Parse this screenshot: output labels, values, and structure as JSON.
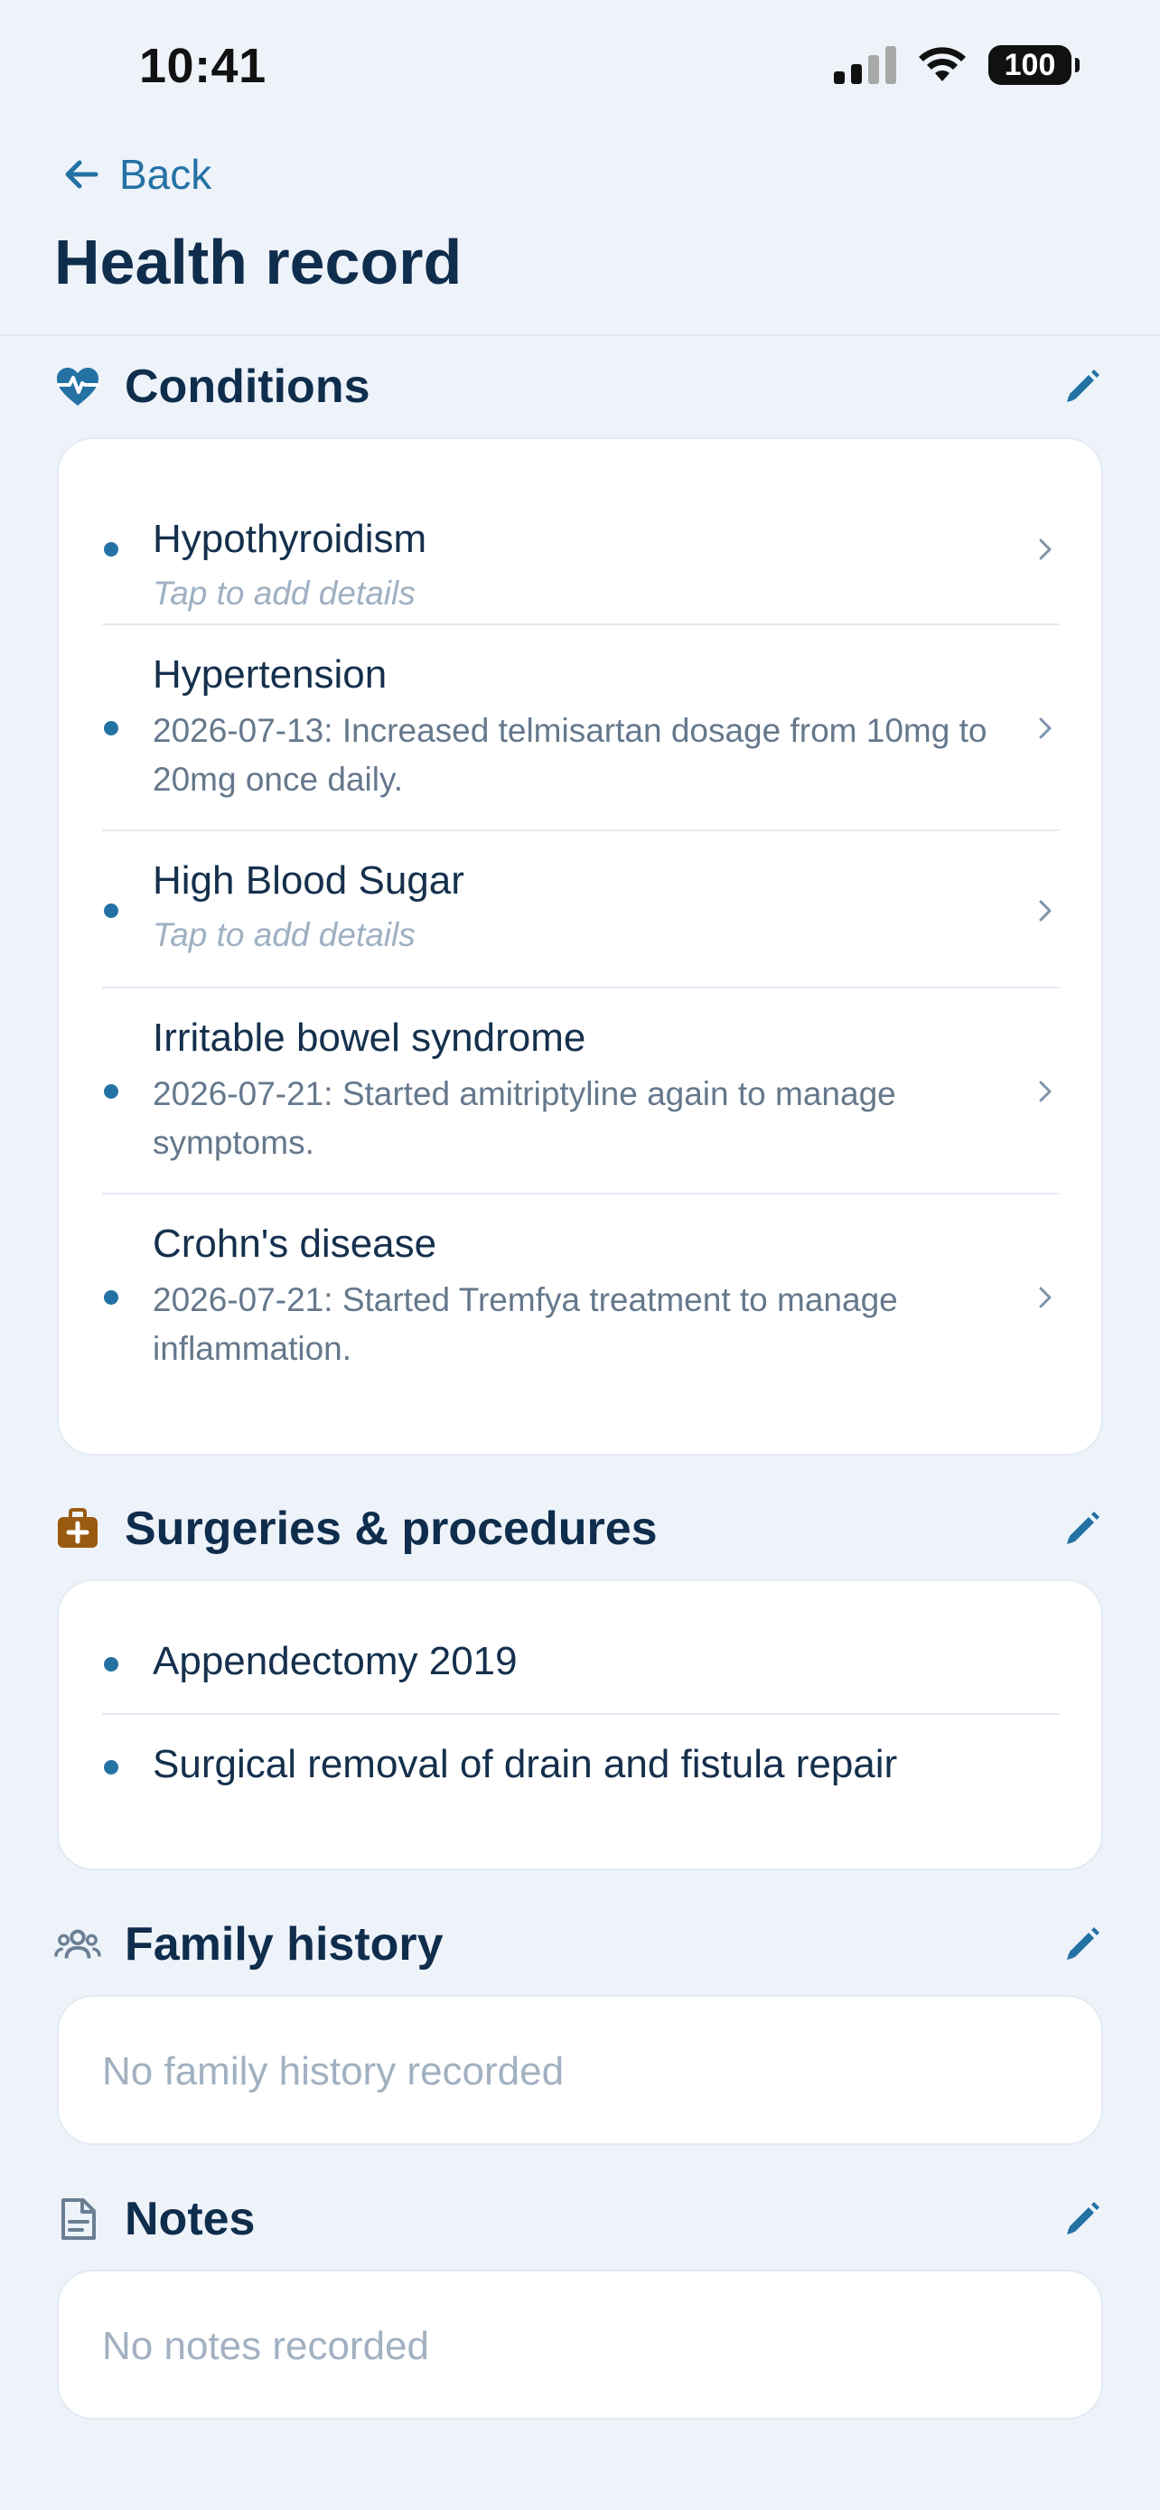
{
  "status_bar": {
    "time": "10:41",
    "battery": "100"
  },
  "header": {
    "back_label": "Back",
    "title": "Health record"
  },
  "conditions": {
    "title": "Conditions",
    "items": [
      {
        "name": "Hypothyroidism",
        "detail": "Tap to add details"
      },
      {
        "name": "Hypertension",
        "detail": "2026-07-13: Increased telmisartan dosage from 10mg to 20mg once daily."
      },
      {
        "name": "High Blood Sugar",
        "detail": "Tap to add details"
      },
      {
        "name": "Irritable bowel syndrome",
        "detail": "2026-07-21: Started amitriptyline again to manage symptoms."
      },
      {
        "name": "Crohn's disease",
        "detail": "2026-07-21: Started Tremfya treatment to manage inflammation."
      }
    ]
  },
  "surgeries": {
    "title": "Surgeries & procedures",
    "items": [
      {
        "name": "Appendectomy 2019"
      },
      {
        "name": "Surgical removal of drain and fistula repair"
      }
    ]
  },
  "family_history": {
    "title": "Family history",
    "empty": "No family history recorded"
  },
  "notes": {
    "title": "Notes",
    "empty": "No notes recorded"
  },
  "colors": {
    "accent": "#2472a4",
    "title": "#0f2d4c",
    "background": "#eef3fa",
    "surgery_icon": "#9a5a10"
  },
  "icons": {
    "back": "arrow-left-icon",
    "conditions": "heart-pulse-icon",
    "surgeries": "medical-bag-icon",
    "family_history": "people-icon",
    "notes": "document-icon",
    "edit": "pencil-icon",
    "chevron": "chevron-right-icon"
  }
}
